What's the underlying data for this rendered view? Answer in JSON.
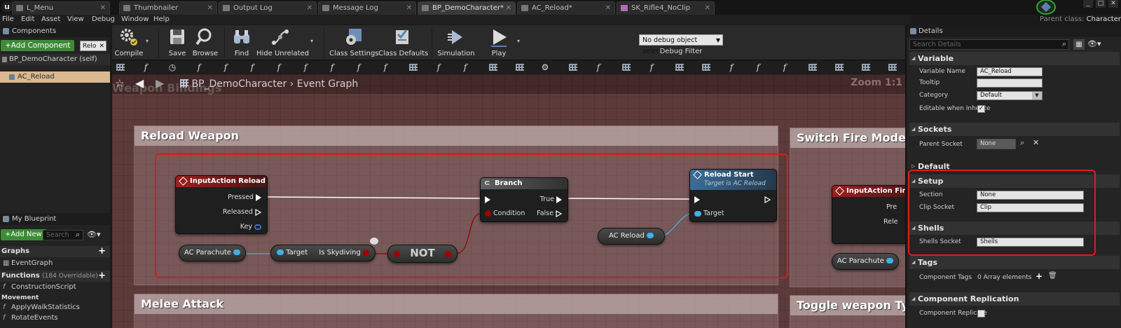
{
  "tabs": [
    {
      "label": "L_Menu"
    },
    {
      "label": "Thumbnailer"
    },
    {
      "label": "Output Log"
    },
    {
      "label": "Message Log"
    },
    {
      "label": "BP_DemoCharacter*"
    },
    {
      "label": "AC_Reload*"
    },
    {
      "label": "SK_Rifle4_NoClip"
    }
  ],
  "parent_class": {
    "label": "Parent class:",
    "value": "Character"
  },
  "menu": [
    "File",
    "Edit",
    "Asset",
    "View",
    "Debug",
    "Window",
    "Help"
  ],
  "components": {
    "title": "Components",
    "add_button": "+Add Component",
    "reload_box": "Relo",
    "self_row": "BP_DemoCharacter (self)",
    "items": [
      "AC_Reload"
    ]
  },
  "my_blueprint": {
    "title": "My Blueprint",
    "add_new": "+Add New",
    "search_placeholder": "Search",
    "graphs_label": "Graphs",
    "event_graph": "EventGraph",
    "functions_label": "Functions",
    "functions_sub": "(184 Overridable)",
    "construction_script": "ConstructionScript",
    "category_movement": "Movement",
    "apply_walk": "ApplyWalkStatistics",
    "rotate_events": "RotateEvents"
  },
  "toolbar": {
    "compile": "Compile",
    "save": "Save",
    "browse": "Browse",
    "find": "Find",
    "hide_unrelated": "Hide Unrelated",
    "class_settings": "Class Settings",
    "class_defaults": "Class Defaults",
    "simulation": "Simulation",
    "play": "Play",
    "debug_object": "No debug object selected",
    "debug_filter": "Debug Filter"
  },
  "graph": {
    "ghost_title": "Weapon Bindings",
    "breadcrumb_root": "BP_DemoCharacter",
    "breadcrumb_sep": "›",
    "breadcrumb_leaf": "Event Graph",
    "zoom": "Zoom 1:1",
    "comments": [
      {
        "title": "Reload Weapon"
      },
      {
        "title": "Switch Fire Modes"
      },
      {
        "title": "Melee Attack"
      },
      {
        "title": "Toggle weapon Type"
      }
    ],
    "input_action_reload": {
      "title": "InputAction Reload",
      "pins": [
        "Pressed",
        "Released",
        "Key"
      ]
    },
    "branch": {
      "title": "Branch",
      "true": "True",
      "false": "False",
      "condition": "Condition"
    },
    "reload_start": {
      "title": "Reload Start",
      "subtitle": "Target is AC Reload",
      "target": "Target"
    },
    "ac_parachute": "AC Parachute",
    "is_skydiving": {
      "target": "Target",
      "output": "Is Skydiving"
    },
    "not_node": "NOT",
    "ac_reload_var": "AC Reload",
    "input_action_fire": {
      "title": "InputAction FireMo",
      "pin1": "Pre",
      "pin2": "Rele"
    },
    "ac_parachute_2": "AC Parachute"
  },
  "details": {
    "title": "Details",
    "search_placeholder": "Search Details",
    "sections": {
      "variable": "Variable",
      "sockets": "Sockets",
      "default": "Default",
      "setup": "Setup",
      "shells": "Shells",
      "tags": "Tags",
      "replication": "Component Replication"
    },
    "variable_name_label": "Variable Name",
    "variable_name": "AC_Reload",
    "tooltip_label": "Tooltip",
    "tooltip": "",
    "category_label": "Category",
    "category": "Default",
    "editable_label": "Editable when Inherite",
    "parent_socket_label": "Parent Socket",
    "parent_socket": "None",
    "section_label": "Section",
    "section": "None",
    "clip_socket_label": "Clip Socket",
    "clip_socket": "Clip",
    "shells_socket_label": "Shells Socket",
    "shells_socket": "Shells",
    "component_tags_label": "Component Tags",
    "component_tags": "0 Array elements",
    "component_replicates_label": "Component Replicate"
  },
  "colors": {
    "graph_bg": "#5d3b3b",
    "event_header": "#8b1b1b",
    "function_header": "#3a6b94",
    "highlight_red": "#e01a1a",
    "green_button": "#3d8b37",
    "selected_row": "#d9b98f"
  }
}
